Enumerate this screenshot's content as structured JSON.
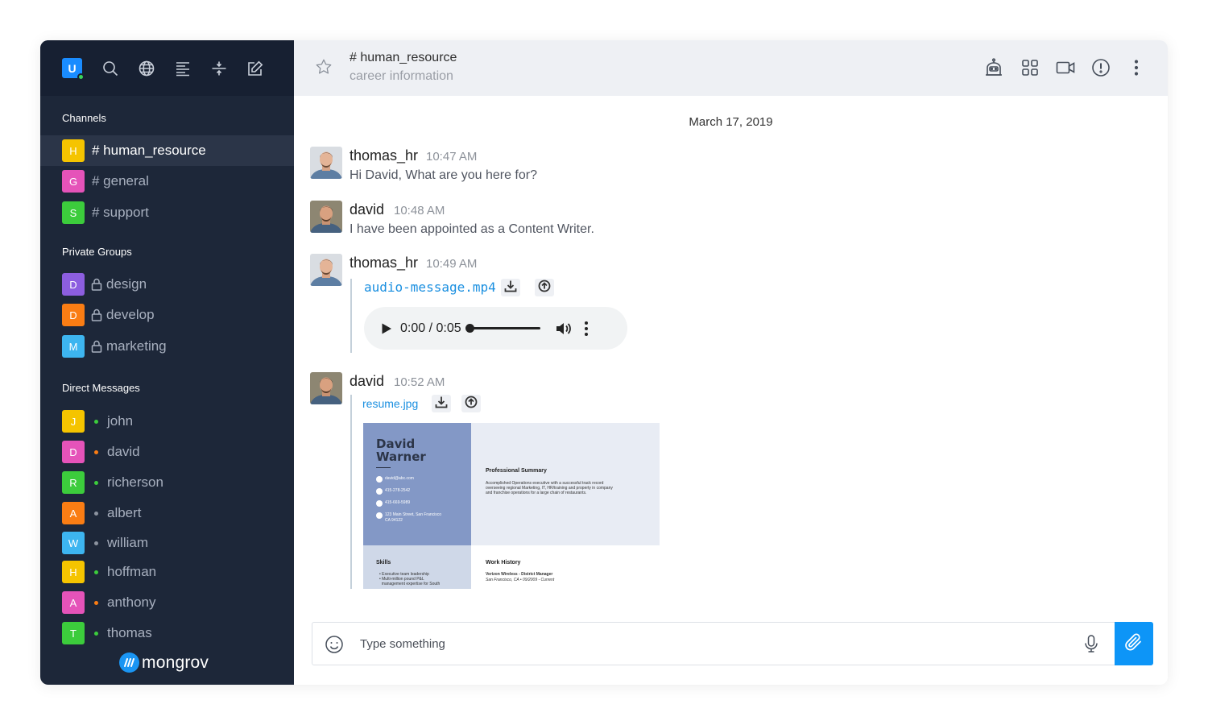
{
  "user": {
    "initial": "U",
    "status_color": "#3ad55a"
  },
  "sidebar": {
    "top_icons": [
      "search-icon",
      "globe-icon",
      "align-left-icon",
      "split-icon",
      "edit-icon"
    ],
    "channels_title": "Channels",
    "channels": [
      {
        "initial": "H",
        "label": "# human_resource",
        "color": "#f5c400",
        "active": true
      },
      {
        "initial": "G",
        "label": "# general",
        "color": "#e553b9"
      },
      {
        "initial": "S",
        "label": "# support",
        "color": "#3ccc3c"
      }
    ],
    "groups_title": "Private Groups",
    "groups": [
      {
        "initial": "D",
        "label": "design",
        "color": "#8c5ee0"
      },
      {
        "initial": "D",
        "label": "develop",
        "color": "#fa7d14"
      },
      {
        "initial": "M",
        "label": "marketing",
        "color": "#3db5f0"
      }
    ],
    "dm_title": "Direct Messages",
    "dms": [
      {
        "initial": "J",
        "label": "john",
        "color": "#f5c400",
        "status": "#3ccc3c"
      },
      {
        "initial": "D",
        "label": "david",
        "color": "#e553b9",
        "status": "#fa7d14"
      },
      {
        "initial": "R",
        "label": "richerson",
        "color": "#3ccc3c",
        "status": "#3ccc3c"
      },
      {
        "initial": "A",
        "label": "albert",
        "color": "#fa7d14",
        "status": "#8c93a0"
      },
      {
        "initial": "W",
        "label": "william",
        "color": "#3db5f0",
        "status": "#8c93a0"
      },
      {
        "initial": "H",
        "label": "hoffman",
        "color": "#f5c400",
        "status": "#3ccc3c"
      },
      {
        "initial": "A",
        "label": "anthony",
        "color": "#e553b9",
        "status": "#fa7d14"
      },
      {
        "initial": "T",
        "label": "thomas",
        "color": "#3ccc3c",
        "status": "#3ccc3c"
      }
    ],
    "brand": "mongrov"
  },
  "header": {
    "channel": "# human_resource",
    "topic": "career information",
    "icons": [
      "robot-icon",
      "grid-icon",
      "video-icon",
      "info-icon",
      "more-vertical-icon"
    ]
  },
  "chat": {
    "date": "March 17, 2019",
    "messages": [
      {
        "name": "thomas_hr",
        "time": "10:47 AM",
        "text": "Hi David, What are you here for?"
      },
      {
        "name": "david",
        "time": "10:48 AM",
        "text": "I have been appointed as a Content Writer."
      },
      {
        "name": "thomas_hr",
        "time": "10:49 AM",
        "file": "audio-message.mp4",
        "audio_time": "0:00 / 0:05",
        "progress": 0
      },
      {
        "name": "david",
        "time": "10:52 AM",
        "file": "resume.jpg"
      }
    ]
  },
  "resume": {
    "first": "David",
    "last": "Warner",
    "contacts": [
      "david@abc.com",
      "415-278-2542",
      "415-669-5989",
      "123 Main Street, San Francisco",
      "CA 94122"
    ],
    "summary_title": "Professional Summary",
    "summary_lines": [
      "Accomplished Operations executive with a successful track record",
      "overseeing regional Marketing, IT, HR/training and property in company",
      "and franchise operations for a large chain of restaurants."
    ],
    "skills_title": "Skills",
    "skills": [
      "Executive team leadership",
      "Multi-million pound P&L",
      "management expertise for South"
    ],
    "work_title": "Work History",
    "work_role": "Verizon Wireless - District Manager",
    "work_place": "San Francisco, CA • 09/2009 - Current"
  },
  "composer": {
    "placeholder": "Type something"
  }
}
